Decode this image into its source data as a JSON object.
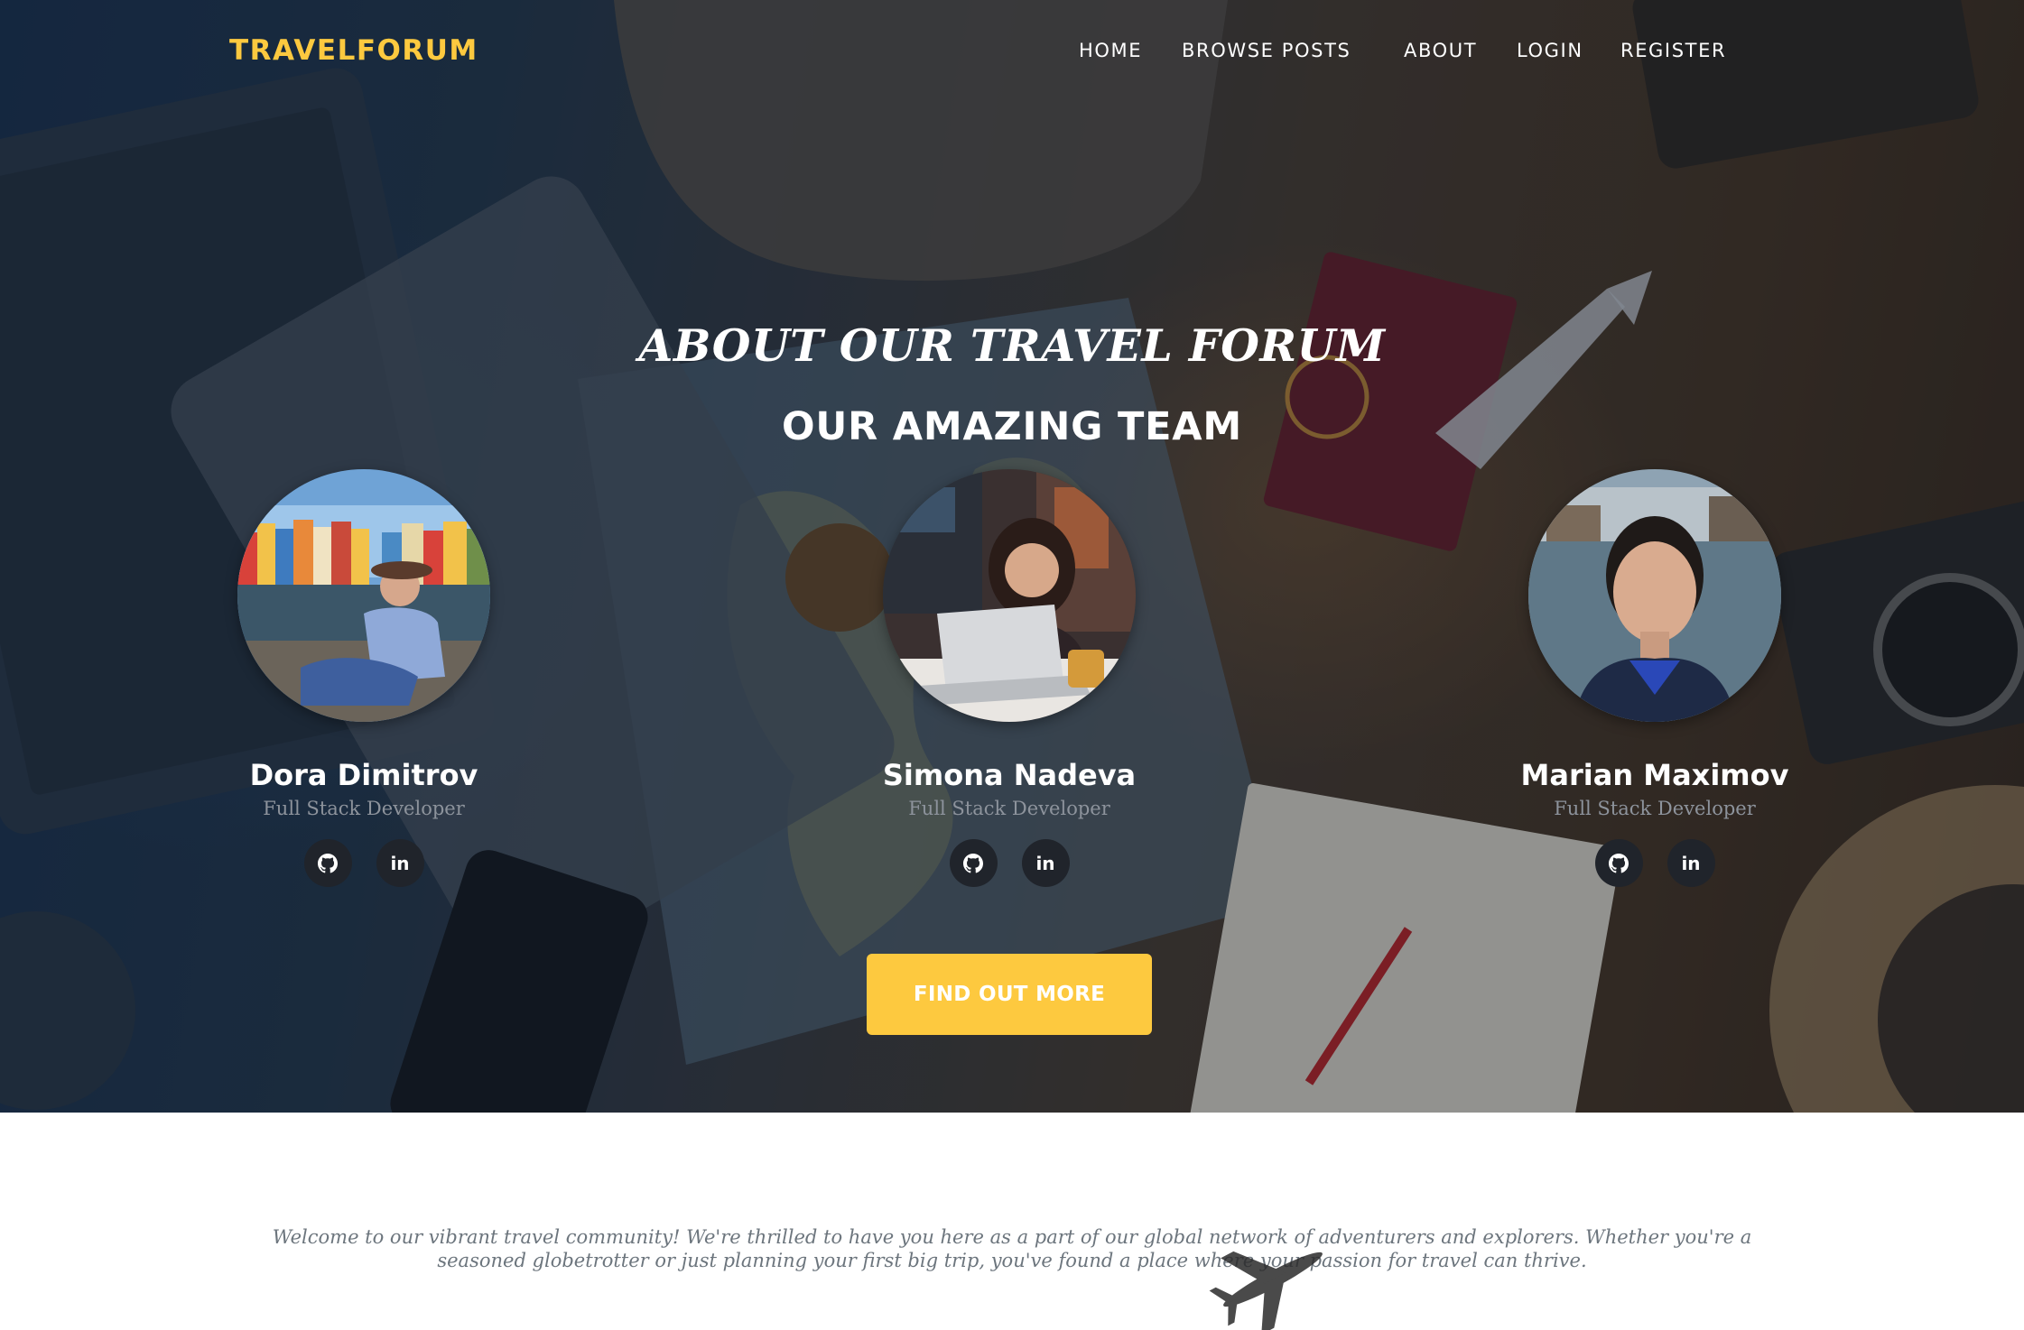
{
  "brand": "TRAVELFORUM",
  "nav": {
    "items": [
      {
        "label": "HOME"
      },
      {
        "label": "BROWSE POSTS"
      },
      {
        "label": "ABOUT"
      },
      {
        "label": "LOGIN"
      },
      {
        "label": "REGISTER"
      }
    ]
  },
  "hero": {
    "title": "ABOUT OUR TRAVEL FORUM",
    "subtitle": "OUR AMAZING TEAM",
    "cta_label": "FIND OUT MORE"
  },
  "team": [
    {
      "name": "Dora Dimitrov",
      "role": "Full Stack Developer",
      "photo": "harbor-portrait-photo"
    },
    {
      "name": "Simona Nadeva",
      "role": "Full Stack Developer",
      "photo": "laptop-portrait-photo"
    },
    {
      "name": "Marian Maximov",
      "role": "Full Stack Developer",
      "photo": "river-portrait-photo"
    }
  ],
  "socials": {
    "github_icon": "github-icon",
    "linkedin_label": "in"
  },
  "welcome": {
    "text": "Welcome to our vibrant travel community! We're thrilled to have you here as a part of our global network of adventurers and explorers. Whether you're a seasoned globetrotter or just planning your first big trip, you've found a place where your passion for travel can thrive."
  },
  "colors": {
    "accent": "#fdc93f",
    "social_bg": "#20242b",
    "role_text": "#8d939c",
    "body_text": "#6c757d"
  }
}
